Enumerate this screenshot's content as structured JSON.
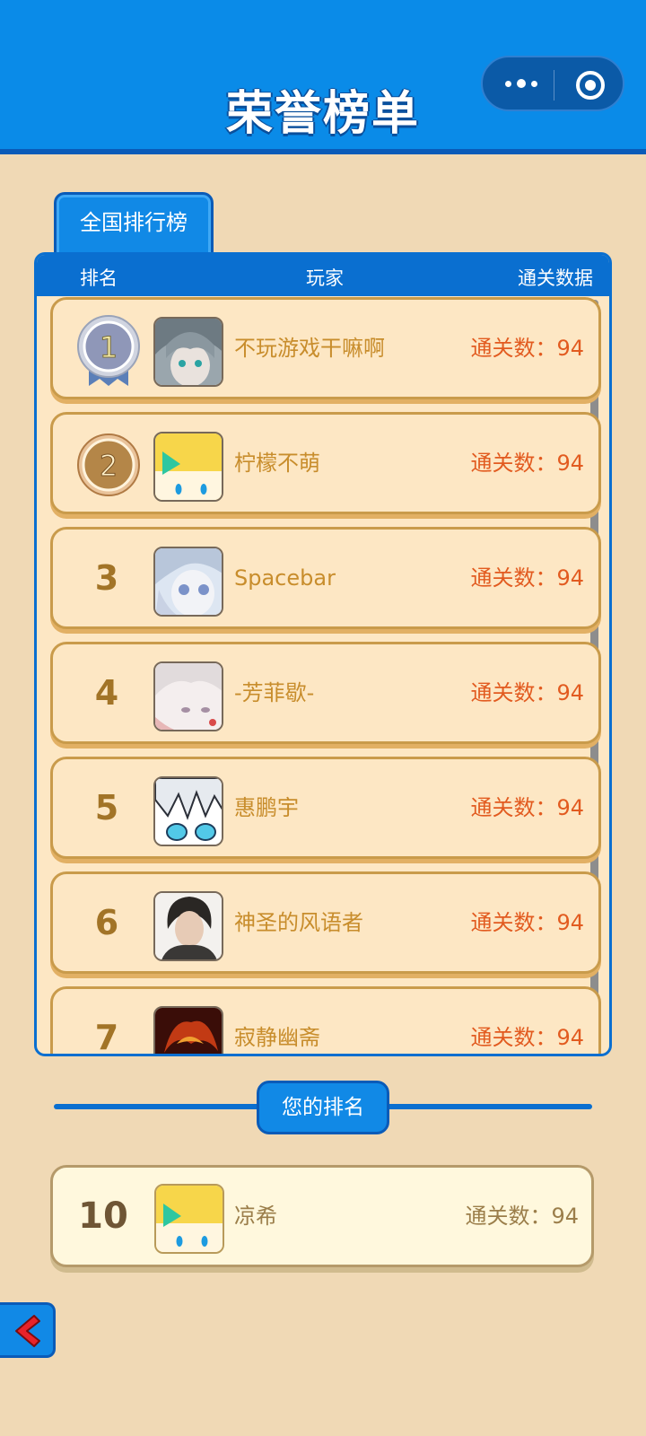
{
  "header": {
    "title": "荣誉榜单",
    "menu_icon": "more-dots-icon",
    "close_icon": "target-close-icon"
  },
  "tabs": [
    {
      "label": "全国排行榜",
      "active": true
    }
  ],
  "table": {
    "columns": [
      "排名",
      "玩家",
      "通关数据"
    ],
    "rows": [
      {
        "rank": "1",
        "name": "不玩游戏干嘛啊",
        "score": "通关数：94",
        "badge": "silver-medal"
      },
      {
        "rank": "2",
        "name": "柠檬不萌",
        "score": "通关数：94",
        "badge": "bronze-medal"
      },
      {
        "rank": "3",
        "name": "Spacebar",
        "score": "通关数：94"
      },
      {
        "rank": "4",
        "name": "-芳菲歇-",
        "score": "通关数：94"
      },
      {
        "rank": "5",
        "name": "惠鹏宇",
        "score": "通关数：94"
      },
      {
        "rank": "6",
        "name": "神圣的风语者",
        "score": "通关数：94"
      },
      {
        "rank": "7",
        "name": "寂静幽斋",
        "score": "通关数：94"
      }
    ]
  },
  "my_rank": {
    "section_label": "您的排名",
    "rank": "10",
    "name": "凉希",
    "score": "通关数：94"
  },
  "back_button": {
    "icon": "chevron-left-icon"
  },
  "colors": {
    "primary_blue": "#0a8be8",
    "background": "#f0d9b5",
    "row_fill": "#fde7c4",
    "name_text": "#c88d2c",
    "score_text": "#e25b20"
  }
}
